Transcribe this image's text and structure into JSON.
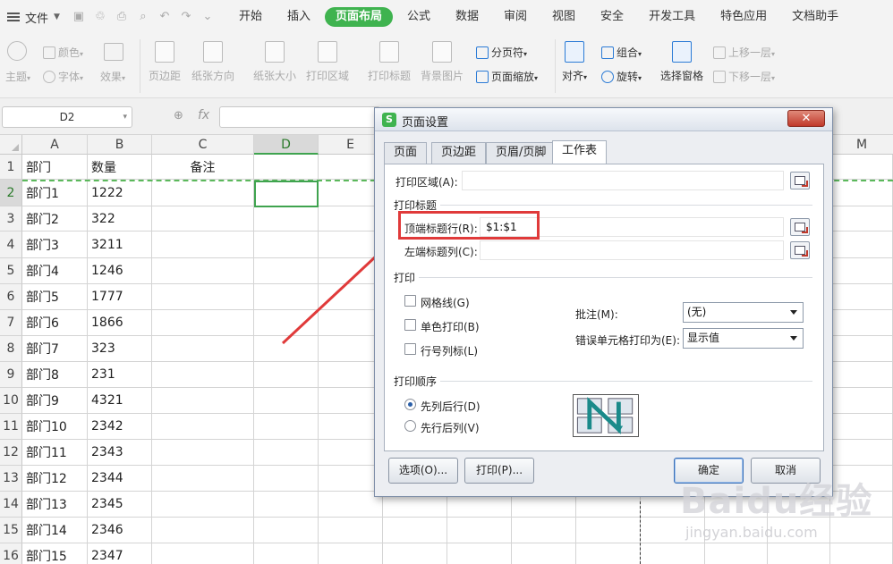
{
  "menubar": {
    "file": "文件",
    "tabs": [
      "开始",
      "插入",
      "页面布局",
      "公式",
      "数据",
      "审阅",
      "视图",
      "安全",
      "开发工具",
      "特色应用",
      "文档助手"
    ],
    "active_tab": "页面布局"
  },
  "ribbon": {
    "theme": "主题",
    "color": "颜色",
    "font": "字体",
    "effect": "效果",
    "margin": "页边距",
    "orientation": "纸张方向",
    "size": "纸张大小",
    "print_area": "打印区域",
    "print_titles": "打印标题",
    "background": "背景图片",
    "page_break": "分页符",
    "page_zoom": "页面缩放",
    "align": "对齐",
    "group": "组合",
    "rotate": "旋转",
    "selection_pane": "选择窗格",
    "bring_forward": "上移一层",
    "send_backward": "下移一层"
  },
  "formula_bar": {
    "name_box": "D2",
    "fx": "fx"
  },
  "sheet": {
    "columns": [
      "A",
      "B",
      "C",
      "D",
      "E"
    ],
    "extra_column": "M",
    "selected_column": "D",
    "selected_row": "2",
    "rows": [
      {
        "num": "1",
        "a": "部门",
        "b": "数量",
        "c": "备注"
      },
      {
        "num": "2",
        "a": "部门1",
        "b": "1222",
        "c": ""
      },
      {
        "num": "3",
        "a": "部门2",
        "b": "322",
        "c": ""
      },
      {
        "num": "4",
        "a": "部门3",
        "b": "3211",
        "c": ""
      },
      {
        "num": "5",
        "a": "部门4",
        "b": "1246",
        "c": ""
      },
      {
        "num": "6",
        "a": "部门5",
        "b": "1777",
        "c": ""
      },
      {
        "num": "7",
        "a": "部门6",
        "b": "1866",
        "c": ""
      },
      {
        "num": "8",
        "a": "部门7",
        "b": "323",
        "c": ""
      },
      {
        "num": "9",
        "a": "部门8",
        "b": "231",
        "c": ""
      },
      {
        "num": "10",
        "a": "部门9",
        "b": "4321",
        "c": ""
      },
      {
        "num": "11",
        "a": "部门10",
        "b": "2342",
        "c": ""
      },
      {
        "num": "12",
        "a": "部门11",
        "b": "2343",
        "c": ""
      },
      {
        "num": "13",
        "a": "部门12",
        "b": "2344",
        "c": ""
      },
      {
        "num": "14",
        "a": "部门13",
        "b": "2345",
        "c": ""
      },
      {
        "num": "15",
        "a": "部门14",
        "b": "2346",
        "c": ""
      },
      {
        "num": "16",
        "a": "部门15",
        "b": "2347",
        "c": ""
      }
    ]
  },
  "dialog": {
    "title": "页面设置",
    "logo": "S",
    "close": "✕",
    "tabs": [
      "页面",
      "页边距",
      "页眉/页脚",
      "工作表"
    ],
    "active_tab": "工作表",
    "print_area_label": "打印区域(A):",
    "print_area_value": "",
    "print_titles_group": "打印标题",
    "top_rows_label": "顶端标题行(R):",
    "top_rows_value": "$1:$1",
    "left_cols_label": "左端标题列(C):",
    "left_cols_value": "",
    "print_group": "打印",
    "gridlines": "网格线(G)",
    "mono": "单色打印(B)",
    "headings": "行号列标(L)",
    "comments_label": "批注(M):",
    "comments_value": "(无)",
    "errors_label": "错误单元格打印为(E):",
    "errors_value": "显示值",
    "order_group": "打印顺序",
    "order_down_then_over": "先列后行(D)",
    "order_over_then_down": "先行后列(V)",
    "options_btn": "选项(O)...",
    "print_btn": "打印(P)...",
    "ok_btn": "确定",
    "cancel_btn": "取消"
  },
  "watermark": {
    "main": "Baidu经验",
    "sub": "jingyan.baidu.com"
  },
  "colors": {
    "accent": "#3fb34f",
    "annotation": "#e03a3a"
  }
}
